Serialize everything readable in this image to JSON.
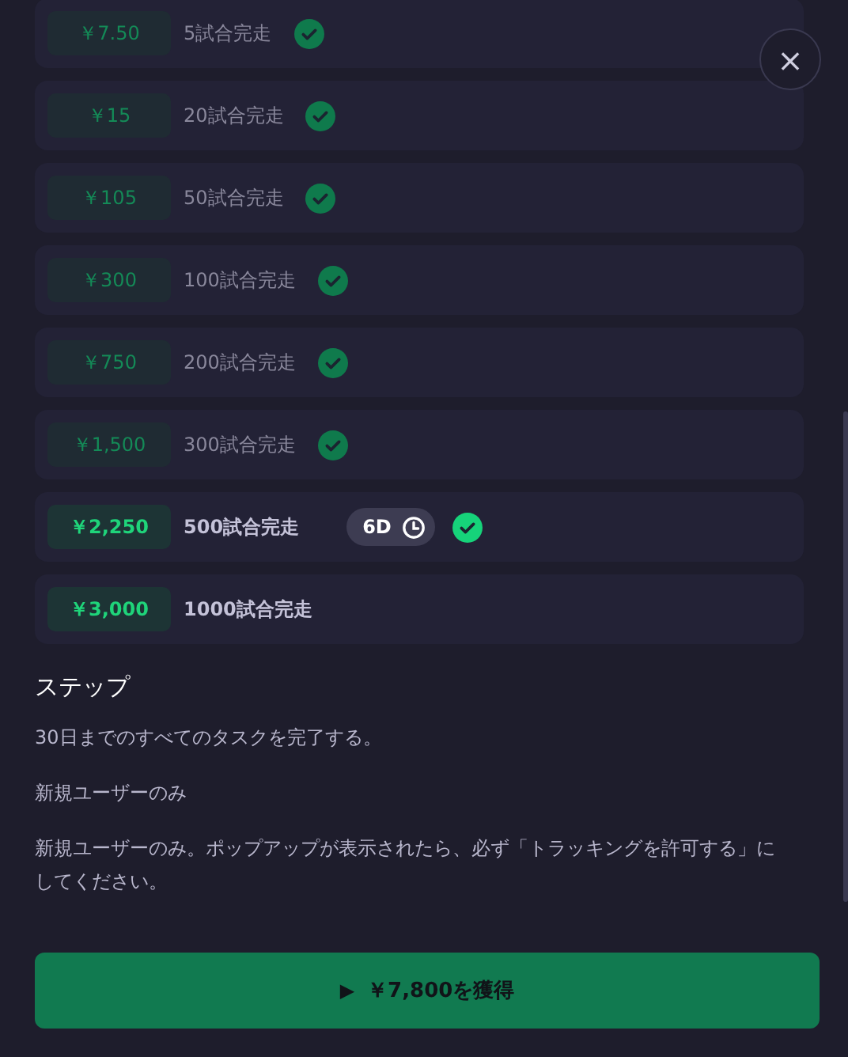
{
  "milestones": [
    {
      "reward": "￥7.50",
      "goal": "5試合完走",
      "claimed": true,
      "checked": true
    },
    {
      "reward": "￥15",
      "goal": "20試合完走",
      "claimed": true,
      "checked": true
    },
    {
      "reward": "￥105",
      "goal": "50試合完走",
      "claimed": true,
      "checked": true
    },
    {
      "reward": "￥300",
      "goal": "100試合完走",
      "claimed": true,
      "checked": true
    },
    {
      "reward": "￥750",
      "goal": "200試合完走",
      "claimed": true,
      "checked": true
    },
    {
      "reward": "￥1,500",
      "goal": "300試合完走",
      "claimed": true,
      "checked": true
    },
    {
      "reward": "￥2,250",
      "goal": "500試合完走",
      "claimed": false,
      "checked": true,
      "timer": "6D"
    },
    {
      "reward": "￥3,000",
      "goal": "1000試合完走",
      "claimed": false,
      "checked": false
    }
  ],
  "steps": {
    "title": "ステップ",
    "paragraphs": [
      "30日までのすべてのタスクを完了する。",
      "新規ユーザーのみ",
      "新規ユーザーのみ。ポップアップが表示されたら、必ず「トラッキングを許可する」にしてください。"
    ]
  },
  "claim_button": {
    "icon": "▶",
    "label": "￥7,800を獲得"
  },
  "close_button": {
    "icon": "×"
  }
}
